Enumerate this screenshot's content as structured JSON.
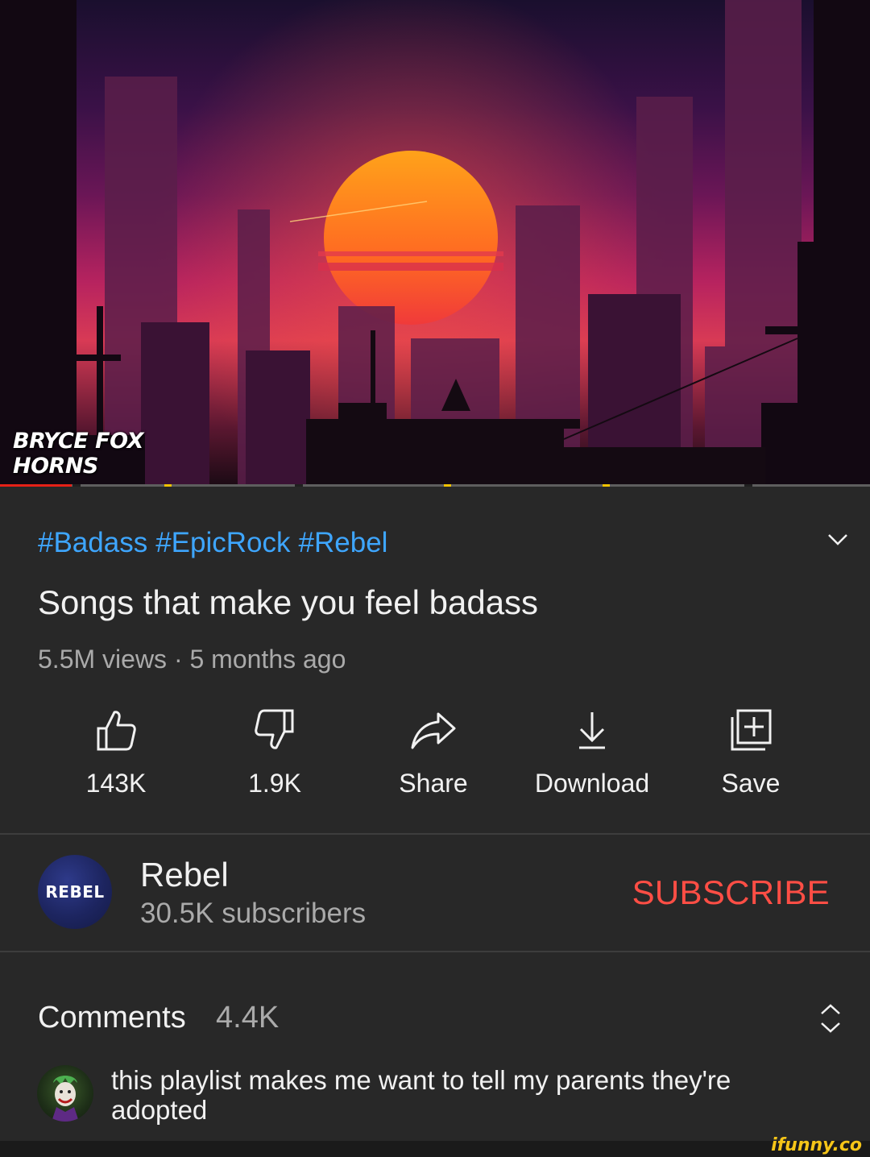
{
  "player": {
    "overlay_line1": "BRYCE FOX",
    "overlay_line2": "HORNS",
    "progress_fraction": 0.082,
    "progress_color": "#e62117",
    "marker_color": "#f2c200"
  },
  "video": {
    "hashtags": [
      "#Badass",
      "#EpicRock",
      "#Rebel"
    ],
    "title": "Songs that make you feel badass",
    "meta": "5.5M views · 5 months ago"
  },
  "actions": {
    "like": {
      "label": "143K",
      "icon": "thumbs-up-icon"
    },
    "dislike": {
      "label": "1.9K",
      "icon": "thumbs-down-icon"
    },
    "share": {
      "label": "Share",
      "icon": "share-arrow-icon"
    },
    "download": {
      "label": "Download",
      "icon": "download-icon"
    },
    "save": {
      "label": "Save",
      "icon": "add-to-playlist-icon"
    }
  },
  "channel": {
    "avatar_text": "REBEL",
    "name": "Rebel",
    "subscribers": "30.5K subscribers",
    "subscribe_label": "SUBSCRIBE",
    "subscribe_color": "#ff4e45"
  },
  "comments": {
    "label": "Comments",
    "count": "4.4K",
    "top_comment": "this playlist makes me want to tell my parents they're adopted"
  },
  "watermark": "ifunny.co"
}
